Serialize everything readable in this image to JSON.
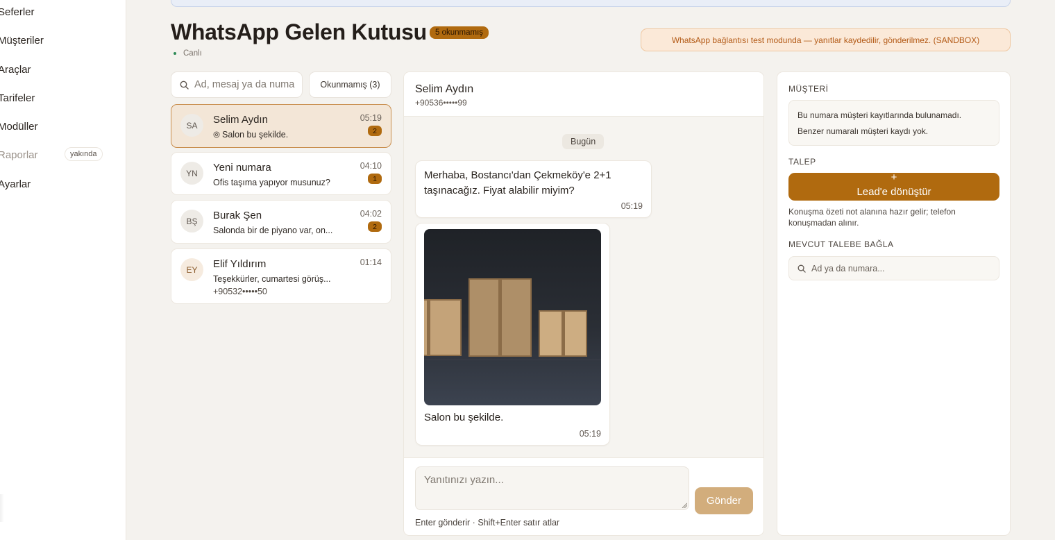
{
  "sidebar": {
    "items": [
      {
        "label": "Seferler"
      },
      {
        "label": "Müşteriler"
      },
      {
        "label": "Araçlar"
      },
      {
        "label": "Tarifeler"
      },
      {
        "label": "Modüller"
      },
      {
        "label": "Raporlar",
        "badge": "yakında"
      },
      {
        "label": "Ayarlar"
      }
    ]
  },
  "header": {
    "title": "WhatsApp Gelen Kutusu",
    "unread_pill": "5 okunmamış",
    "live_status": "Canlı",
    "sandbox_notice": "WhatsApp bağlantısı test modunda — yanıtlar kaydedilir, gönderilmez. (SANDBOX)"
  },
  "inbox": {
    "search_placeholder": "Ad, mesaj ya da numara",
    "filter_label": "Okunmamış (3)",
    "conversations": [
      {
        "initials": "SA",
        "name": "Selim Aydın",
        "preview": "Salon bu şekilde.",
        "preview_icon": "camera-icon",
        "time": "05:19",
        "unread": "2",
        "active": true
      },
      {
        "initials": "YN",
        "name": "Yeni numara",
        "preview": "Ofis taşıma yapıyor musunuz?",
        "time": "04:10",
        "unread": "1"
      },
      {
        "initials": "BŞ",
        "name": "Burak Şen",
        "preview": "Salonda bir de piyano var, on...",
        "time": "04:02",
        "unread": "2"
      },
      {
        "initials": "EY",
        "name": "Elif Yıldırım",
        "preview": "Teşekkürler, cumartesi görüş...",
        "phone": "+90532•••••50",
        "time": "01:14"
      }
    ]
  },
  "chat": {
    "contact_name": "Selim Aydın",
    "contact_phone": "+90536•••••99",
    "day_label": "Bugün",
    "messages": [
      {
        "line1": "Merhaba, Bostancı'dan Çekmeköy'e 2+1",
        "line2": "taşınacağız. Fiyat alabilir miyim?",
        "time": "05:19"
      },
      {
        "image": "boxes-photo",
        "caption": "Salon bu şekilde.",
        "time": "05:19"
      }
    ],
    "composer": {
      "placeholder": "Yanıtınızı yazın...",
      "send_label": "Gönder",
      "hint": "Enter gönderir · Shift+Enter satır atlar"
    }
  },
  "details": {
    "customer_label": "MÜŞTERİ",
    "customer_not_found": "Bu numara müşteri kayıtlarında bulunamadı.",
    "customer_no_similar": "Benzer numaralı müşteri kaydı yok.",
    "request_label": "TALEP",
    "lead_plus": "+",
    "lead_button": "Lead'e dönüştür",
    "lead_note": "Konuşma özeti not alanına hazır gelir; telefon konuşmadan alınır.",
    "link_label": "MEVCUT TALEBE BAĞLA",
    "link_placeholder": "Ad ya da numara..."
  },
  "colors": {
    "accent": "#b06a0f",
    "accent_soft": "#d2ad7c",
    "sandbox_text": "#b35a16",
    "live": "#2e8b57"
  }
}
